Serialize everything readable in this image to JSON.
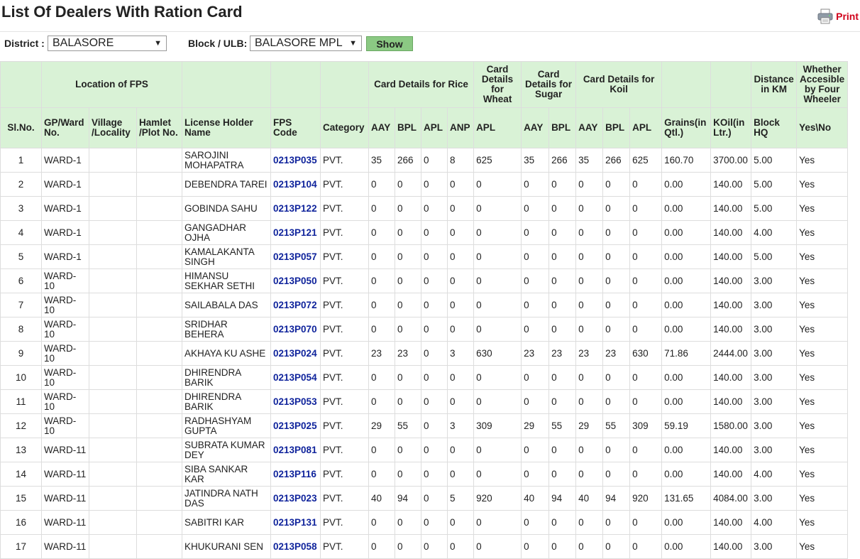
{
  "title": "List Of Dealers With Ration Card",
  "print_label": "Print",
  "filters": {
    "district_label": "District :",
    "district_value": "BALASORE",
    "block_label": "Block / ULB:",
    "block_value": "BALASORE MPL",
    "show_label": "Show"
  },
  "header_top": {
    "location": "Location of FPS",
    "rice": "Card Details for Rice",
    "wheat": "Card Details for Wheat",
    "sugar": "Card Details for Sugar",
    "koil": "Card Details for Koil",
    "distance": "Distance in KM",
    "accessible": "Whether Accesible by Four Wheeler"
  },
  "header_sub": [
    "Sl.No.",
    "GP/Ward No.",
    "Village /Locality",
    "Hamlet /Plot No.",
    "License Holder Name",
    "FPS Code",
    "Category",
    "AAY",
    "BPL",
    "APL",
    "ANP",
    "APL",
    "AAY",
    "BPL",
    "AAY",
    "BPL",
    "APL",
    "Grains(in Qtl.)",
    "KOil(in Ltr.)",
    "Block HQ",
    "Yes\\No"
  ],
  "rows": [
    {
      "sl": "1",
      "ward": "WARD-1",
      "village": "",
      "hamlet": "",
      "name": "SAROJINI MOHAPATRA",
      "fps": "0213P035",
      "cat": "PVT.",
      "r_aay": "35",
      "r_bpl": "266",
      "r_apl": "0",
      "r_anp": "8",
      "w_apl": "625",
      "s_aay": "35",
      "s_bpl": "266",
      "k_aay": "35",
      "k_bpl": "266",
      "k_apl": "625",
      "grains": "160.70",
      "koil": "3700.00",
      "dist": "5.00",
      "yes": "Yes"
    },
    {
      "sl": "2",
      "ward": "WARD-1",
      "village": "",
      "hamlet": "",
      "name": "DEBENDRA TAREI",
      "fps": "0213P104",
      "cat": "PVT.",
      "r_aay": "0",
      "r_bpl": "0",
      "r_apl": "0",
      "r_anp": "0",
      "w_apl": "0",
      "s_aay": "0",
      "s_bpl": "0",
      "k_aay": "0",
      "k_bpl": "0",
      "k_apl": "0",
      "grains": "0.00",
      "koil": "140.00",
      "dist": "5.00",
      "yes": "Yes"
    },
    {
      "sl": "3",
      "ward": "WARD-1",
      "village": "",
      "hamlet": "",
      "name": "GOBINDA SAHU",
      "fps": "0213P122",
      "cat": "PVT.",
      "r_aay": "0",
      "r_bpl": "0",
      "r_apl": "0",
      "r_anp": "0",
      "w_apl": "0",
      "s_aay": "0",
      "s_bpl": "0",
      "k_aay": "0",
      "k_bpl": "0",
      "k_apl": "0",
      "grains": "0.00",
      "koil": "140.00",
      "dist": "5.00",
      "yes": "Yes"
    },
    {
      "sl": "4",
      "ward": "WARD-1",
      "village": "",
      "hamlet": "",
      "name": "GANGADHAR OJHA",
      "fps": "0213P121",
      "cat": "PVT.",
      "r_aay": "0",
      "r_bpl": "0",
      "r_apl": "0",
      "r_anp": "0",
      "w_apl": "0",
      "s_aay": "0",
      "s_bpl": "0",
      "k_aay": "0",
      "k_bpl": "0",
      "k_apl": "0",
      "grains": "0.00",
      "koil": "140.00",
      "dist": "4.00",
      "yes": "Yes"
    },
    {
      "sl": "5",
      "ward": "WARD-1",
      "village": "",
      "hamlet": "",
      "name": "KAMALAKANTA SINGH",
      "fps": "0213P057",
      "cat": "PVT.",
      "r_aay": "0",
      "r_bpl": "0",
      "r_apl": "0",
      "r_anp": "0",
      "w_apl": "0",
      "s_aay": "0",
      "s_bpl": "0",
      "k_aay": "0",
      "k_bpl": "0",
      "k_apl": "0",
      "grains": "0.00",
      "koil": "140.00",
      "dist": "5.00",
      "yes": "Yes"
    },
    {
      "sl": "6",
      "ward": "WARD-10",
      "village": "",
      "hamlet": "",
      "name": "HIMANSU SEKHAR SETHI",
      "fps": "0213P050",
      "cat": "PVT.",
      "r_aay": "0",
      "r_bpl": "0",
      "r_apl": "0",
      "r_anp": "0",
      "w_apl": "0",
      "s_aay": "0",
      "s_bpl": "0",
      "k_aay": "0",
      "k_bpl": "0",
      "k_apl": "0",
      "grains": "0.00",
      "koil": "140.00",
      "dist": "3.00",
      "yes": "Yes"
    },
    {
      "sl": "7",
      "ward": "WARD-10",
      "village": "",
      "hamlet": "",
      "name": "SAILABALA DAS",
      "fps": "0213P072",
      "cat": "PVT.",
      "r_aay": "0",
      "r_bpl": "0",
      "r_apl": "0",
      "r_anp": "0",
      "w_apl": "0",
      "s_aay": "0",
      "s_bpl": "0",
      "k_aay": "0",
      "k_bpl": "0",
      "k_apl": "0",
      "grains": "0.00",
      "koil": "140.00",
      "dist": "3.00",
      "yes": "Yes"
    },
    {
      "sl": "8",
      "ward": "WARD-10",
      "village": "",
      "hamlet": "",
      "name": "SRIDHAR BEHERA",
      "fps": "0213P070",
      "cat": "PVT.",
      "r_aay": "0",
      "r_bpl": "0",
      "r_apl": "0",
      "r_anp": "0",
      "w_apl": "0",
      "s_aay": "0",
      "s_bpl": "0",
      "k_aay": "0",
      "k_bpl": "0",
      "k_apl": "0",
      "grains": "0.00",
      "koil": "140.00",
      "dist": "3.00",
      "yes": "Yes"
    },
    {
      "sl": "9",
      "ward": "WARD-10",
      "village": "",
      "hamlet": "",
      "name": "AKHAYA KU ASHE",
      "fps": "0213P024",
      "cat": "PVT.",
      "r_aay": "23",
      "r_bpl": "23",
      "r_apl": "0",
      "r_anp": "3",
      "w_apl": "630",
      "s_aay": "23",
      "s_bpl": "23",
      "k_aay": "23",
      "k_bpl": "23",
      "k_apl": "630",
      "grains": "71.86",
      "koil": "2444.00",
      "dist": "3.00",
      "yes": "Yes"
    },
    {
      "sl": "10",
      "ward": "WARD-10",
      "village": "",
      "hamlet": "",
      "name": "DHIRENDRA BARIK",
      "fps": "0213P054",
      "cat": "PVT.",
      "r_aay": "0",
      "r_bpl": "0",
      "r_apl": "0",
      "r_anp": "0",
      "w_apl": "0",
      "s_aay": "0",
      "s_bpl": "0",
      "k_aay": "0",
      "k_bpl": "0",
      "k_apl": "0",
      "grains": "0.00",
      "koil": "140.00",
      "dist": "3.00",
      "yes": "Yes"
    },
    {
      "sl": "11",
      "ward": "WARD-10",
      "village": "",
      "hamlet": "",
      "name": "DHIRENDRA BARIK",
      "fps": "0213P053",
      "cat": "PVT.",
      "r_aay": "0",
      "r_bpl": "0",
      "r_apl": "0",
      "r_anp": "0",
      "w_apl": "0",
      "s_aay": "0",
      "s_bpl": "0",
      "k_aay": "0",
      "k_bpl": "0",
      "k_apl": "0",
      "grains": "0.00",
      "koil": "140.00",
      "dist": "3.00",
      "yes": "Yes"
    },
    {
      "sl": "12",
      "ward": "WARD-10",
      "village": "",
      "hamlet": "",
      "name": "RADHASHYAM GUPTA",
      "fps": "0213P025",
      "cat": "PVT.",
      "r_aay": "29",
      "r_bpl": "55",
      "r_apl": "0",
      "r_anp": "3",
      "w_apl": "309",
      "s_aay": "29",
      "s_bpl": "55",
      "k_aay": "29",
      "k_bpl": "55",
      "k_apl": "309",
      "grains": "59.19",
      "koil": "1580.00",
      "dist": "3.00",
      "yes": "Yes"
    },
    {
      "sl": "13",
      "ward": "WARD-11",
      "village": "",
      "hamlet": "",
      "name": "SUBRATA KUMAR DEY",
      "fps": "0213P081",
      "cat": "PVT.",
      "r_aay": "0",
      "r_bpl": "0",
      "r_apl": "0",
      "r_anp": "0",
      "w_apl": "0",
      "s_aay": "0",
      "s_bpl": "0",
      "k_aay": "0",
      "k_bpl": "0",
      "k_apl": "0",
      "grains": "0.00",
      "koil": "140.00",
      "dist": "3.00",
      "yes": "Yes"
    },
    {
      "sl": "14",
      "ward": "WARD-11",
      "village": "",
      "hamlet": "",
      "name": "SIBA SANKAR KAR",
      "fps": "0213P116",
      "cat": "PVT.",
      "r_aay": "0",
      "r_bpl": "0",
      "r_apl": "0",
      "r_anp": "0",
      "w_apl": "0",
      "s_aay": "0",
      "s_bpl": "0",
      "k_aay": "0",
      "k_bpl": "0",
      "k_apl": "0",
      "grains": "0.00",
      "koil": "140.00",
      "dist": "4.00",
      "yes": "Yes"
    },
    {
      "sl": "15",
      "ward": "WARD-11",
      "village": "",
      "hamlet": "",
      "name": "JATINDRA NATH DAS",
      "fps": "0213P023",
      "cat": "PVT.",
      "r_aay": "40",
      "r_bpl": "94",
      "r_apl": "0",
      "r_anp": "5",
      "w_apl": "920",
      "s_aay": "40",
      "s_bpl": "94",
      "k_aay": "40",
      "k_bpl": "94",
      "k_apl": "920",
      "grains": "131.65",
      "koil": "4084.00",
      "dist": "3.00",
      "yes": "Yes"
    },
    {
      "sl": "16",
      "ward": "WARD-11",
      "village": "",
      "hamlet": "",
      "name": "SABITRI KAR",
      "fps": "0213P131",
      "cat": "PVT.",
      "r_aay": "0",
      "r_bpl": "0",
      "r_apl": "0",
      "r_anp": "0",
      "w_apl": "0",
      "s_aay": "0",
      "s_bpl": "0",
      "k_aay": "0",
      "k_bpl": "0",
      "k_apl": "0",
      "grains": "0.00",
      "koil": "140.00",
      "dist": "4.00",
      "yes": "Yes"
    },
    {
      "sl": "17",
      "ward": "WARD-11",
      "village": "",
      "hamlet": "",
      "name": "KHUKURANI SEN",
      "fps": "0213P058",
      "cat": "PVT.",
      "r_aay": "0",
      "r_bpl": "0",
      "r_apl": "0",
      "r_anp": "0",
      "w_apl": "0",
      "s_aay": "0",
      "s_bpl": "0",
      "k_aay": "0",
      "k_bpl": "0",
      "k_apl": "0",
      "grains": "0.00",
      "koil": "140.00",
      "dist": "3.00",
      "yes": "Yes"
    }
  ],
  "colors": {
    "header_bg": "#d9f2d6",
    "fps_link": "#10249c",
    "print_text": "#d0021b",
    "show_button": "#8bc983"
  },
  "icons": {
    "print": "printer-icon",
    "dropdown": "chevron-down-icon"
  }
}
